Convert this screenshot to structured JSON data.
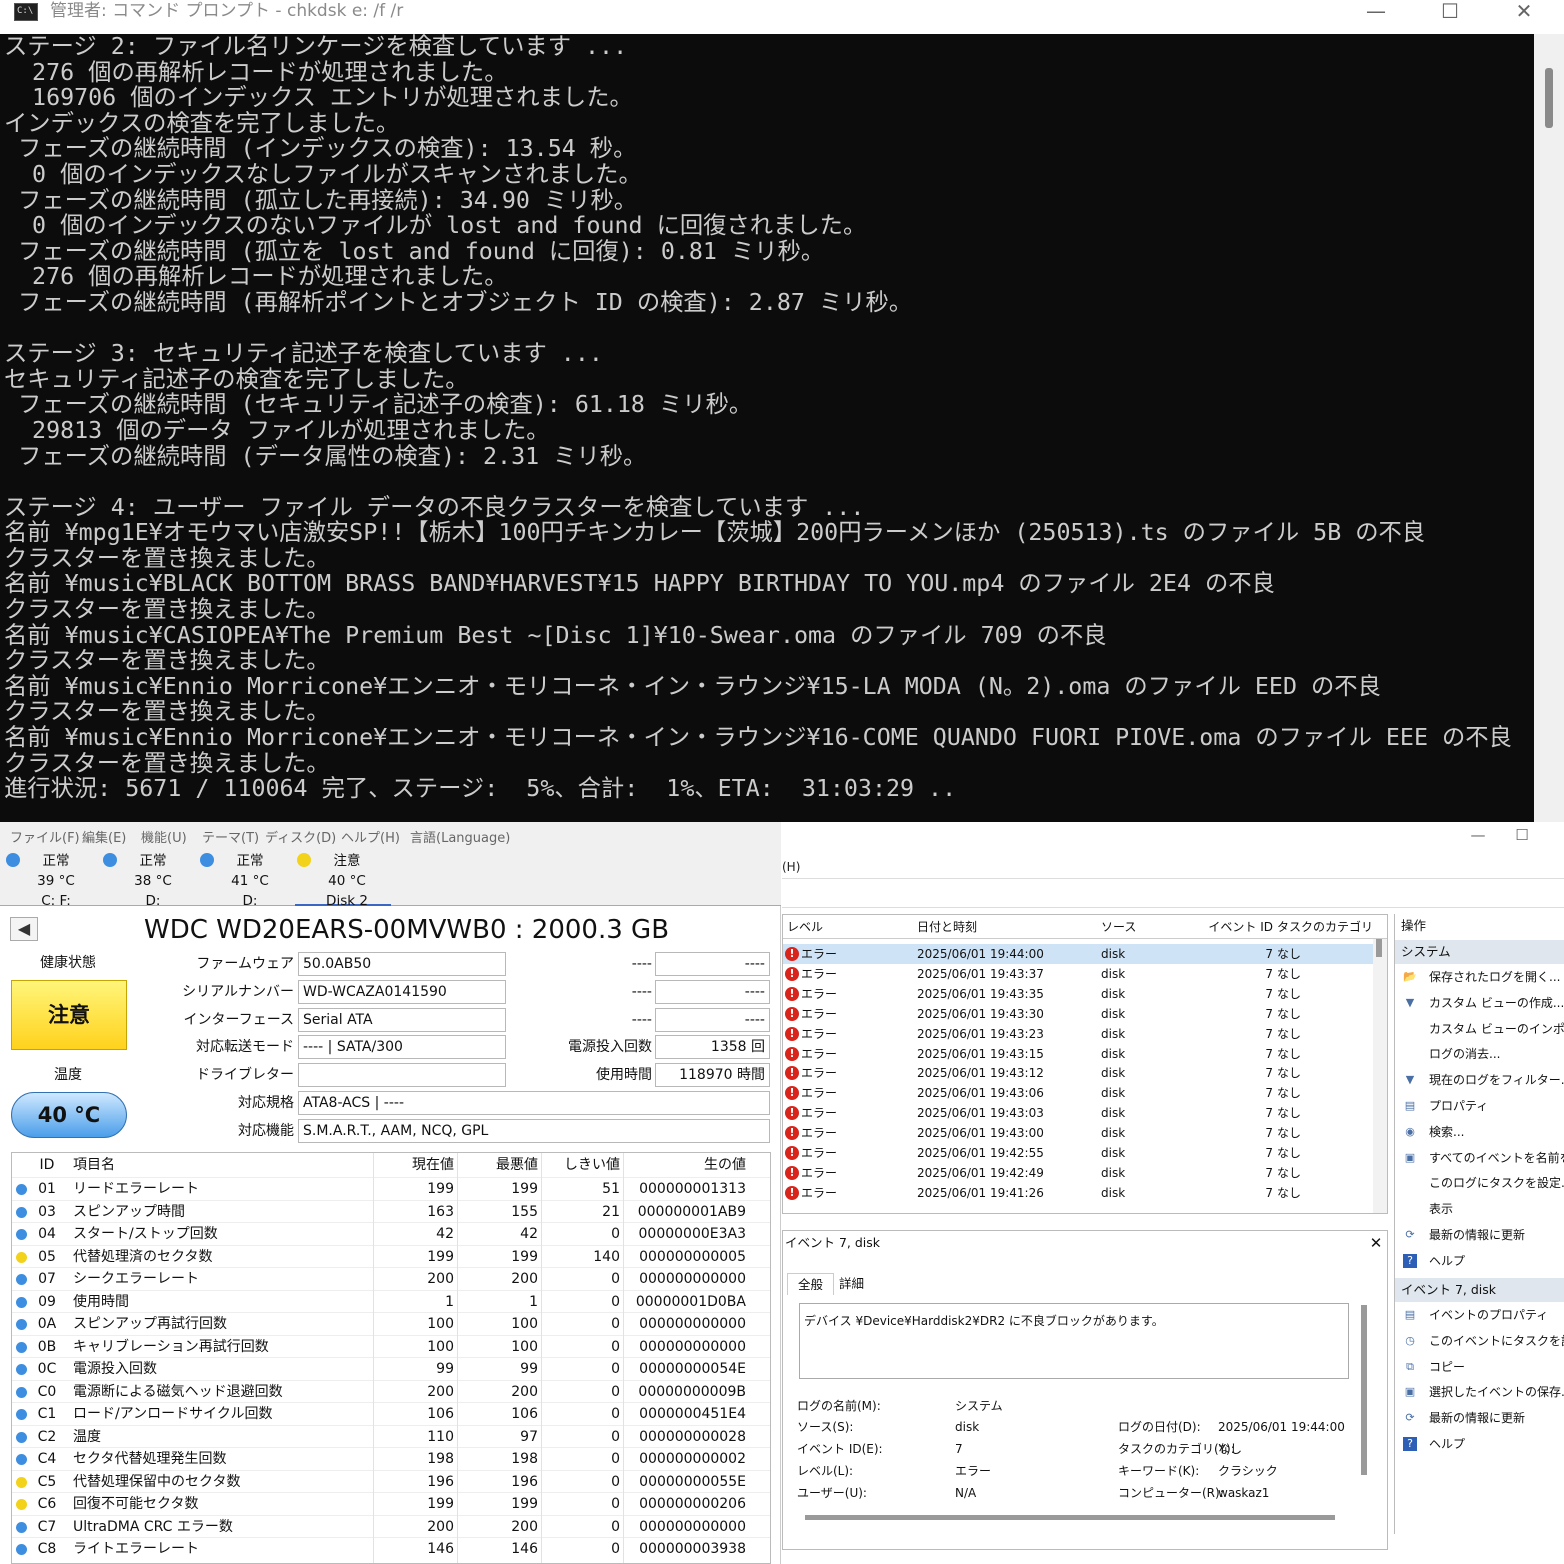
{
  "console": {
    "title": "管理者: コマンド プロンプト - chkdsk  e: /f /r",
    "lines": [
      "ステージ 2: ファイル名リンケージを検査しています ...",
      "  276 個の再解析レコードが処理されました。",
      "  169706 個のインデックス エントリが処理されました。",
      "インデックスの検査を完了しました。",
      " フェーズの継続時間 (インデックスの検査): 13.54 秒。",
      "  0 個のインデックスなしファイルがスキャンされました。",
      " フェーズの継続時間 (孤立した再接続): 34.90 ミリ秒。",
      "  0 個のインデックスのないファイルが lost and found に回復されました。",
      " フェーズの継続時間 (孤立を lost and found に回復): 0.81 ミリ秒。",
      "  276 個の再解析レコードが処理されました。",
      " フェーズの継続時間 (再解析ポイントとオブジェクト ID の検査): 2.87 ミリ秒。",
      "",
      "ステージ 3: セキュリティ記述子を検査しています ...",
      "セキュリティ記述子の検査を完了しました。",
      " フェーズの継続時間 (セキュリティ記述子の検査): 61.18 ミリ秒。",
      "  29813 個のデータ ファイルが処理されました。",
      " フェーズの継続時間 (データ属性の検査): 2.31 ミリ秒。",
      "",
      "ステージ 4: ユーザー ファイル データの不良クラスターを検査しています ...",
      "名前 ¥mpg1E¥オモウマい店激安SP!!【栃木】100円チキンカレー【茨城】200円ラーメンほか (250513).ts のファイル 5B の不良",
      "クラスターを置き換えました。",
      "名前 ¥music¥BLACK BOTTOM BRASS BAND¥HARVEST¥15 HAPPY BIRTHDAY TO YOU.mp4 のファイル 2E4 の不良",
      "クラスターを置き換えました。",
      "名前 ¥music¥CASIOPEA¥The Premium Best ~[Disc 1]¥10-Swear.oma のファイル 709 の不良",
      "クラスターを置き換えました。",
      "名前 ¥music¥Ennio Morricone¥エンニオ・モリコーネ・イン・ラウンジ¥15-LA MODA (N。2).oma のファイル EED の不良",
      "クラスターを置き換えました。",
      "名前 ¥music¥Ennio Morricone¥エンニオ・モリコーネ・イン・ラウンジ¥16-COME QUANDO FUORI PIOVE.oma のファイル EEE の不良",
      "クラスターを置き換えました。",
      "進行状況: 5671 / 110064 完了、ステージ:  5%、合計:  1%、ETA:  31:03:29 .."
    ]
  },
  "cdi": {
    "menu": [
      "ファイル(F)",
      "編集(E)",
      "機能(U)",
      "テーマ(T)",
      "ディスク(D)",
      "ヘルプ(H)",
      "言語(Language)"
    ],
    "drives": [
      {
        "status": "正常",
        "temp": "39 °C",
        "letter": "C: F:",
        "color": "#3d8ee0"
      },
      {
        "status": "正常",
        "temp": "38 °C",
        "letter": "D:",
        "color": "#3d8ee0"
      },
      {
        "status": "正常",
        "temp": "41 °C",
        "letter": "D:",
        "color": "#3d8ee0"
      },
      {
        "status": "注意",
        "temp": "40 °C",
        "letter": "Disk 2",
        "color": "#f2d21a"
      }
    ],
    "prev_icon": "triangle-left-icon",
    "model": "WDC WD20EARS-00MVWB0 : 2000.3 GB",
    "health_label": "健康状態",
    "health_status": "注意",
    "temp_label": "温度",
    "temperature": "40 °C",
    "info": {
      "firmware_label": "ファームウェア",
      "firmware": "50.0AB50",
      "serial_label": "シリアルナンバー",
      "serial": "WD-WCAZA0141590",
      "interface_label": "インターフェース",
      "interface": "Serial ATA",
      "transfer_label": "対応転送モード",
      "transfer": "---- | SATA/300",
      "drive_letter_label": "ドライブレター",
      "drive_letter": "",
      "standard_label": "対応規格",
      "standard": "ATA8-ACS | ----",
      "features_label": "対応機能",
      "features": "S.M.A.R.T., AAM, NCQ, GPL",
      "dash": "----",
      "power_on_count_label": "電源投入回数",
      "power_on_count": "1358 回",
      "power_on_hours_label": "使用時間",
      "power_on_hours": "118970 時間"
    },
    "smart_headers": [
      "ID",
      "項目名",
      "現在値",
      "最悪値",
      "しきい値",
      "生の値"
    ],
    "smart_rows": [
      {
        "id": "01",
        "name": "リードエラーレート",
        "cur": "199",
        "worst": "199",
        "thr": "51",
        "raw": "000000001313",
        "color": "#3d8ee0"
      },
      {
        "id": "03",
        "name": "スピンアップ時間",
        "cur": "163",
        "worst": "155",
        "thr": "21",
        "raw": "000000001AB9",
        "color": "#3d8ee0"
      },
      {
        "id": "04",
        "name": "スタート/ストップ回数",
        "cur": "42",
        "worst": "42",
        "thr": "0",
        "raw": "00000000E3A3",
        "color": "#3d8ee0"
      },
      {
        "id": "05",
        "name": "代替処理済のセクタ数",
        "cur": "199",
        "worst": "199",
        "thr": "140",
        "raw": "000000000005",
        "color": "#f2d21a"
      },
      {
        "id": "07",
        "name": "シークエラーレート",
        "cur": "200",
        "worst": "200",
        "thr": "0",
        "raw": "000000000000",
        "color": "#3d8ee0"
      },
      {
        "id": "09",
        "name": "使用時間",
        "cur": "1",
        "worst": "1",
        "thr": "0",
        "raw": "00000001D0BA",
        "color": "#3d8ee0"
      },
      {
        "id": "0A",
        "name": "スピンアップ再試行回数",
        "cur": "100",
        "worst": "100",
        "thr": "0",
        "raw": "000000000000",
        "color": "#3d8ee0"
      },
      {
        "id": "0B",
        "name": "キャリブレーション再試行回数",
        "cur": "100",
        "worst": "100",
        "thr": "0",
        "raw": "000000000000",
        "color": "#3d8ee0"
      },
      {
        "id": "0C",
        "name": "電源投入回数",
        "cur": "99",
        "worst": "99",
        "thr": "0",
        "raw": "00000000054E",
        "color": "#3d8ee0"
      },
      {
        "id": "C0",
        "name": "電源断による磁気ヘッド退避回数",
        "cur": "200",
        "worst": "200",
        "thr": "0",
        "raw": "00000000009B",
        "color": "#3d8ee0"
      },
      {
        "id": "C1",
        "name": "ロード/アンロードサイクル回数",
        "cur": "106",
        "worst": "106",
        "thr": "0",
        "raw": "0000000451E4",
        "color": "#3d8ee0"
      },
      {
        "id": "C2",
        "name": "温度",
        "cur": "110",
        "worst": "97",
        "thr": "0",
        "raw": "000000000028",
        "color": "#3d8ee0"
      },
      {
        "id": "C4",
        "name": "セクタ代替処理発生回数",
        "cur": "198",
        "worst": "198",
        "thr": "0",
        "raw": "000000000002",
        "color": "#3d8ee0"
      },
      {
        "id": "C5",
        "name": "代替処理保留中のセクタ数",
        "cur": "196",
        "worst": "196",
        "thr": "0",
        "raw": "00000000055E",
        "color": "#f2d21a"
      },
      {
        "id": "C6",
        "name": "回復不可能セクタ数",
        "cur": "199",
        "worst": "199",
        "thr": "0",
        "raw": "000000000206",
        "color": "#f2d21a"
      },
      {
        "id": "C7",
        "name": "UltraDMA CRC エラー数",
        "cur": "200",
        "worst": "200",
        "thr": "0",
        "raw": "000000000000",
        "color": "#3d8ee0"
      },
      {
        "id": "C8",
        "name": "ライトエラーレート",
        "cur": "146",
        "worst": "146",
        "thr": "0",
        "raw": "000000003938",
        "color": "#3d8ee0"
      }
    ]
  },
  "ev": {
    "menu_h": "(H)",
    "list_headers": [
      "レベル",
      "日付と時刻",
      "ソース",
      "イベント ID",
      "タスクのカテゴリ"
    ],
    "rows": [
      {
        "level": "エラー",
        "date": "2025/06/01 19:44:00",
        "source": "disk",
        "id": "7",
        "task": "なし"
      },
      {
        "level": "エラー",
        "date": "2025/06/01 19:43:37",
        "source": "disk",
        "id": "7",
        "task": "なし"
      },
      {
        "level": "エラー",
        "date": "2025/06/01 19:43:35",
        "source": "disk",
        "id": "7",
        "task": "なし"
      },
      {
        "level": "エラー",
        "date": "2025/06/01 19:43:30",
        "source": "disk",
        "id": "7",
        "task": "なし"
      },
      {
        "level": "エラー",
        "date": "2025/06/01 19:43:23",
        "source": "disk",
        "id": "7",
        "task": "なし"
      },
      {
        "level": "エラー",
        "date": "2025/06/01 19:43:15",
        "source": "disk",
        "id": "7",
        "task": "なし"
      },
      {
        "level": "エラー",
        "date": "2025/06/01 19:43:12",
        "source": "disk",
        "id": "7",
        "task": "なし"
      },
      {
        "level": "エラー",
        "date": "2025/06/01 19:43:06",
        "source": "disk",
        "id": "7",
        "task": "なし"
      },
      {
        "level": "エラー",
        "date": "2025/06/01 19:43:03",
        "source": "disk",
        "id": "7",
        "task": "なし"
      },
      {
        "level": "エラー",
        "date": "2025/06/01 19:43:00",
        "source": "disk",
        "id": "7",
        "task": "なし"
      },
      {
        "level": "エラー",
        "date": "2025/06/01 19:42:55",
        "source": "disk",
        "id": "7",
        "task": "なし"
      },
      {
        "level": "エラー",
        "date": "2025/06/01 19:42:49",
        "source": "disk",
        "id": "7",
        "task": "なし"
      },
      {
        "level": "エラー",
        "date": "2025/06/01 19:41:26",
        "source": "disk",
        "id": "7",
        "task": "なし"
      }
    ],
    "detail_title": "イベント 7, disk",
    "tab_general": "全般",
    "tab_detail": "詳細",
    "message": "デバイス ¥Device¥Harddisk2¥DR2 に不良ブロックがあります。",
    "fields": {
      "log_name_label": "ログの名前(M):",
      "log_name": "システム",
      "source_label": "ソース(S):",
      "source": "disk",
      "event_id_label": "イベント ID(E):",
      "event_id": "7",
      "level_label": "レベル(L):",
      "level": "エラー",
      "user_label": "ユーザー(U):",
      "user": "N/A",
      "logged_label": "ログの日付(D):",
      "logged": "2025/06/01 19:44:00",
      "task_label": "タスクのカテゴリ(Y):",
      "task": "なし",
      "keyword_label": "キーワード(K):",
      "keyword": "クラシック",
      "computer_label": "コンピューター(R):",
      "computer": "waskaz1"
    },
    "actions_title": "操作",
    "section_system": "システム",
    "actions_system": [
      {
        "label": "保存されたログを開く...",
        "icon": "folder-open-icon"
      },
      {
        "label": "カスタム ビューの作成...",
        "icon": "filter-icon"
      },
      {
        "label": "カスタム ビューのインポート...",
        "icon": ""
      },
      {
        "label": "ログの消去...",
        "icon": ""
      },
      {
        "label": "現在のログをフィルター...",
        "icon": "filter-icon"
      },
      {
        "label": "プロパティ",
        "icon": "properties-icon"
      },
      {
        "label": "検索...",
        "icon": "binoculars-icon"
      },
      {
        "label": "すべてのイベントを名前を...",
        "icon": "save-icon"
      },
      {
        "label": "このログにタスクを設定...",
        "icon": ""
      },
      {
        "label": "表示",
        "icon": ""
      },
      {
        "label": "最新の情報に更新",
        "icon": "refresh-icon"
      },
      {
        "label": "ヘルプ",
        "icon": "help-icon"
      }
    ],
    "section_event": "イベント 7, disk",
    "actions_event": [
      {
        "label": "イベントのプロパティ",
        "icon": "properties-icon"
      },
      {
        "label": "このイベントにタスクを設定...",
        "icon": "task-icon"
      },
      {
        "label": "コピー",
        "icon": "copy-icon"
      },
      {
        "label": "選択したイベントの保存...",
        "icon": "save-icon"
      },
      {
        "label": "最新の情報に更新",
        "icon": "refresh-icon"
      },
      {
        "label": "ヘルプ",
        "icon": "help-icon"
      }
    ]
  }
}
